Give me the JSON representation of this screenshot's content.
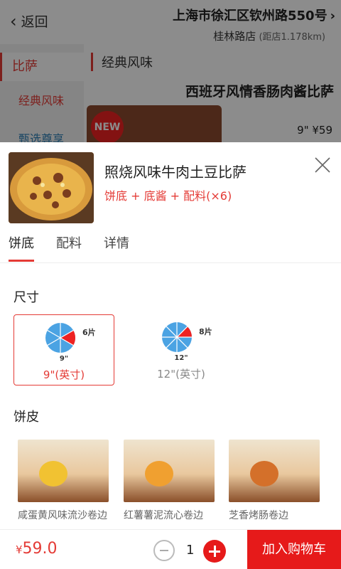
{
  "header": {
    "back_label": "返回",
    "address": "上海市徐汇区钦州路550号",
    "store": "桂林路店",
    "distance": "(距店1.178km)"
  },
  "sidebar": {
    "items": [
      {
        "label": "比萨"
      },
      {
        "label": "经典风味"
      },
      {
        "label": "甄选尊享"
      }
    ]
  },
  "main": {
    "section_title": "经典风味",
    "product_name": "西班牙风情香肠肉酱比萨",
    "new_badge": "NEW",
    "price_line": "9\" ¥59"
  },
  "sheet": {
    "title": "照烧风味牛肉土豆比萨",
    "subtitle": "饼底 + 底酱 + 配料(×6)",
    "tabs": [
      {
        "label": "饼底"
      },
      {
        "label": "配料"
      },
      {
        "label": "详情"
      }
    ],
    "size_label": "尺寸",
    "sizes": [
      {
        "slices": "6片",
        "inch": "9\"",
        "caption": "9\"(英寸)"
      },
      {
        "slices": "8片",
        "inch": "12\"",
        "caption": "12\"(英寸)"
      }
    ],
    "crust_label": "饼皮",
    "crusts": [
      {
        "name": "咸蛋黄风味流沙卷边"
      },
      {
        "name": "红薯薯泥流心卷边"
      },
      {
        "name": "芝香烤肠卷边"
      }
    ]
  },
  "bottom": {
    "currency": "¥",
    "price": "59.0",
    "quantity": "1",
    "add_to_cart": "加入购物车"
  },
  "colors": {
    "accent": "#e43b36",
    "button": "#e61a1a",
    "pie_blue": "#4ba3e3"
  }
}
